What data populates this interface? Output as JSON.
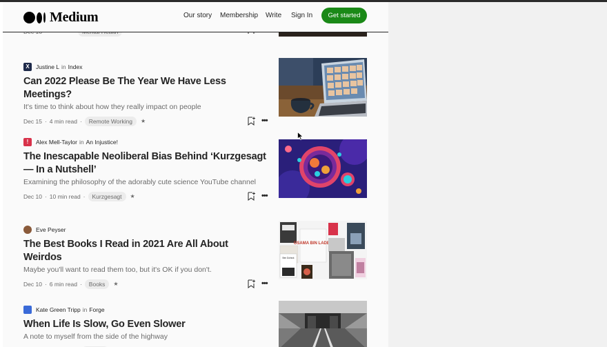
{
  "header": {
    "brand": "Medium",
    "nav": [
      "Our story",
      "Membership",
      "Write",
      "Sign In"
    ],
    "cta": "Get started",
    "accent": "#1a8917"
  },
  "partial_top": {
    "date": "Dec 16",
    "tag": "Mental Health"
  },
  "articles": [
    {
      "author": "Justine L",
      "in": "in",
      "publication": "Index",
      "title": "Can 2022 Please Be The Year We Have Less Meetings?",
      "subtitle": "It's time to think about how they really impact on people",
      "date": "Dec 15",
      "read_time": "4 min read",
      "tag": "Remote Working"
    },
    {
      "author": "Alex Mell-Taylor",
      "in": "in",
      "publication": "An Injustice!",
      "title": "The Inescapable Neoliberal Bias Behind ‘Kurzgesagt— In a Nutshell’",
      "subtitle": "Examining the philosophy of the adorably cute science YouTube channel",
      "date": "Dec 10",
      "read_time": "10 min read",
      "tag": "Kurzgesagt"
    },
    {
      "author": "Eve Peyser",
      "in": "",
      "publication": "",
      "title": "The Best Books I Read in 2021 Are All About Weirdos",
      "subtitle": "Maybe you'll want to read them too, but it's OK if you don't.",
      "date": "Dec 10",
      "read_time": "6 min read",
      "tag": "Books"
    },
    {
      "author": "Kate Green Tripp",
      "in": "in",
      "publication": "Forge",
      "title": "When Life Is Slow, Go Even Slower",
      "subtitle": "A note to myself from the side of the highway"
    }
  ],
  "book_cover_texts": {
    "osama": "OSAMA BIN LADEN",
    "ben": "Ben Dolnick"
  },
  "icons": {
    "star": "★",
    "more": "•••",
    "dot": "·"
  }
}
